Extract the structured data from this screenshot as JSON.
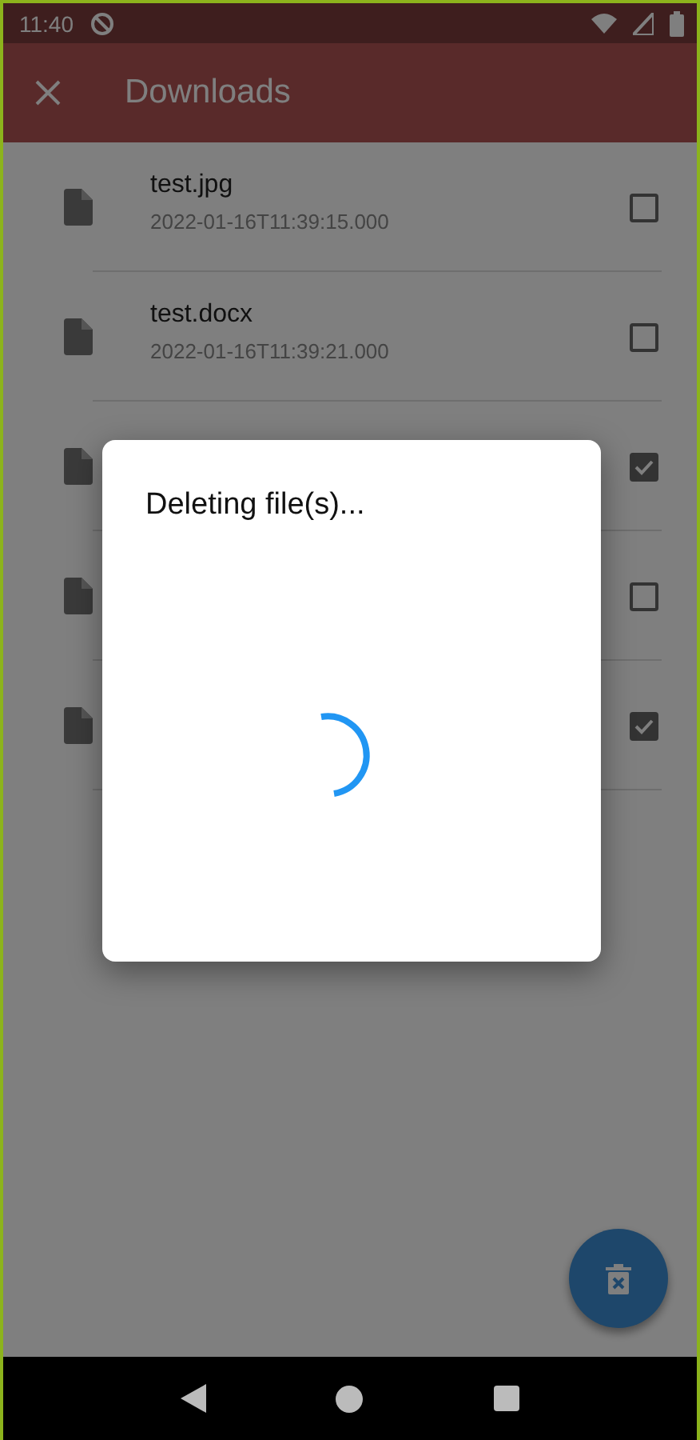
{
  "status_bar": {
    "time": "11:40"
  },
  "app_bar": {
    "title": "Downloads"
  },
  "files": [
    {
      "name": "test.jpg",
      "date": "2022-01-16T11:39:15.000",
      "checked": false
    },
    {
      "name": "test.docx",
      "date": "2022-01-16T11:39:21.000",
      "checked": false
    },
    {
      "checked": true
    },
    {
      "checked": false
    },
    {
      "checked": true
    }
  ],
  "dialog": {
    "message": "Deleting file(s)..."
  }
}
